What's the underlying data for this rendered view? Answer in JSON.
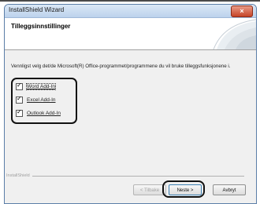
{
  "window": {
    "title": "InstallShield Wizard",
    "close_glyph": "×"
  },
  "header": {
    "title": "Tilleggsinnstillinger"
  },
  "instructions": "Vennligst velg det/de Microsoft(R) Office-programmet/programmene du vil bruke tilleggsfunksjonene i.",
  "options": [
    {
      "label": "Word Add-In",
      "checked": true
    },
    {
      "label": "Excel Add-In",
      "checked": true
    },
    {
      "label": "Outlook Add-In",
      "checked": true
    }
  ],
  "footer": {
    "brand": "InstallShield"
  },
  "buttons": {
    "back": "< Tilbake",
    "next": "Neste >",
    "cancel": "Avbryt"
  }
}
